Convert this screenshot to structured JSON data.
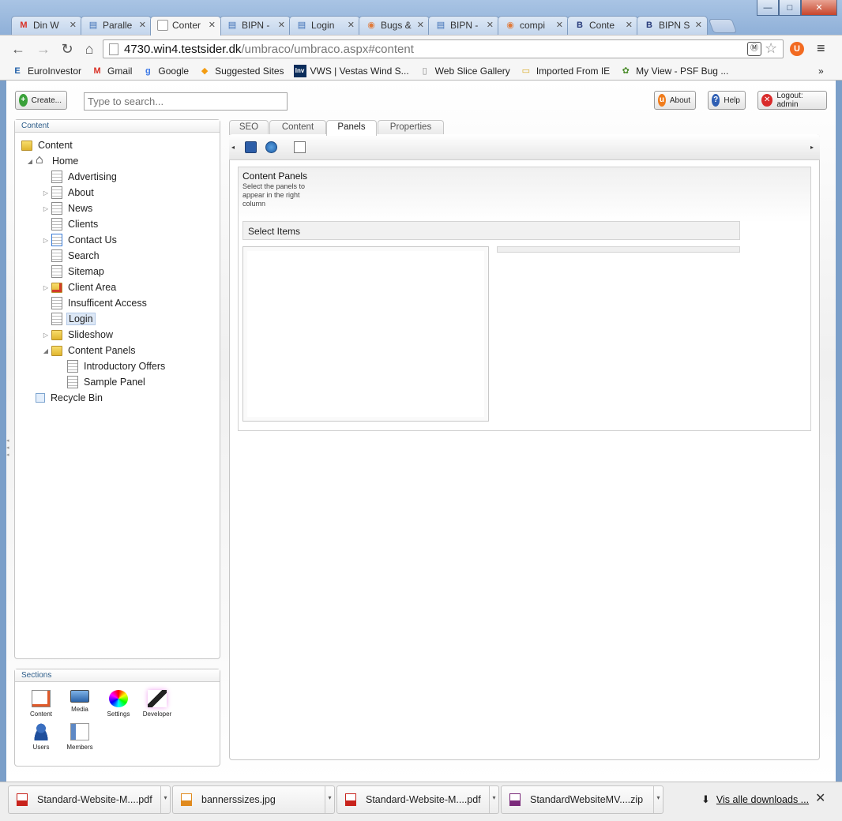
{
  "window": {
    "minimize": "—",
    "maximize": "□",
    "close": "✕"
  },
  "tabs": [
    {
      "label": "Din W",
      "icon": "M",
      "color": "#d93025"
    },
    {
      "label": "Paralle",
      "icon": "▤",
      "color": "#3b6db4"
    },
    {
      "label": "Conter",
      "icon": "",
      "color": "#888888"
    },
    {
      "label": "BIPN -",
      "icon": "▤",
      "color": "#3b6db4"
    },
    {
      "label": "Login",
      "icon": "▤",
      "color": "#3b6db4"
    },
    {
      "label": "Bugs &",
      "icon": "◉",
      "color": "#e07a3a"
    },
    {
      "label": "BIPN -",
      "icon": "▤",
      "color": "#3b6db4"
    },
    {
      "label": "compi",
      "icon": "◉",
      "color": "#e07a3a"
    },
    {
      "label": "Conte",
      "icon": "B",
      "color": "#273a7a"
    },
    {
      "label": "BIPN S",
      "icon": "B",
      "color": "#273a7a"
    }
  ],
  "address": {
    "host": "4730.win4.testsider.dk",
    "path": "/umbraco/umbraco.aspx#content"
  },
  "bookmarks": [
    {
      "label": "EuroInvestor",
      "icon": "E",
      "color": "#1f5fa8"
    },
    {
      "label": "Gmail",
      "icon": "M",
      "color": "#d93025"
    },
    {
      "label": "Google",
      "icon": "g",
      "color": "#3b78e7"
    },
    {
      "label": "Suggested Sites",
      "icon": "◆",
      "color": "#f39c12"
    },
    {
      "label": "VWS | Vestas Wind S...",
      "icon": "Inv",
      "color": "#0b2d5b"
    },
    {
      "label": "Web Slice Gallery",
      "icon": "▯",
      "color": "#888888"
    },
    {
      "label": "Imported From IE",
      "icon": "▭",
      "color": "#d8a922"
    },
    {
      "label": "My View - PSF Bug ...",
      "icon": "✿",
      "color": "#4a8c2a"
    }
  ],
  "bookmarks_more": "»",
  "header": {
    "create_label": "Create...",
    "search_placeholder": "Type to search...",
    "about_label": "About",
    "help_label": "Help",
    "logout_label": "Logout: admin"
  },
  "content_panel": {
    "title": "Content",
    "tree": [
      {
        "label": "Content",
        "type": "folder",
        "level": 0,
        "arrow": ""
      },
      {
        "label": "Home",
        "type": "home",
        "level": 1,
        "arrow": "◢"
      },
      {
        "label": "Advertising",
        "type": "doc",
        "level": 2,
        "arrow": ""
      },
      {
        "label": "About",
        "type": "doc",
        "level": 2,
        "arrow": "▷"
      },
      {
        "label": "News",
        "type": "doc",
        "level": 2,
        "arrow": "▷"
      },
      {
        "label": "Clients",
        "type": "doc",
        "level": 2,
        "arrow": ""
      },
      {
        "label": "Contact Us",
        "type": "redirect",
        "level": 2,
        "arrow": "▷"
      },
      {
        "label": "Search",
        "type": "doc",
        "level": 2,
        "arrow": ""
      },
      {
        "label": "Sitemap",
        "type": "doc",
        "level": 2,
        "arrow": ""
      },
      {
        "label": "Client Area",
        "type": "folder-protected",
        "level": 2,
        "arrow": "▷"
      },
      {
        "label": "Insufficent Access",
        "type": "doc",
        "level": 2,
        "arrow": ""
      },
      {
        "label": "Login",
        "type": "doc",
        "level": 2,
        "arrow": "",
        "selected": true
      },
      {
        "label": "Slideshow",
        "type": "folder",
        "level": 2,
        "arrow": "▷"
      },
      {
        "label": "Content Panels",
        "type": "folder",
        "level": 2,
        "arrow": "◢"
      },
      {
        "label": "Introductory Offers",
        "type": "doc",
        "level": 3,
        "arrow": ""
      },
      {
        "label": "Sample Panel",
        "type": "doc",
        "level": 3,
        "arrow": ""
      },
      {
        "label": "Recycle Bin",
        "type": "bin",
        "level": 1,
        "arrow": ""
      }
    ]
  },
  "sections_panel": {
    "title": "Sections",
    "items": [
      {
        "label": "Content",
        "icon": "pencil-doc-icon"
      },
      {
        "label": "Media",
        "icon": "monitor-icon"
      },
      {
        "label": "Settings",
        "icon": "color-wheel-icon"
      },
      {
        "label": "Developer",
        "icon": "magic-wand-icon"
      },
      {
        "label": "Users",
        "icon": "user-icon"
      },
      {
        "label": "Members",
        "icon": "member-card-icon"
      }
    ]
  },
  "editor": {
    "tabs": [
      "SEO",
      "Content",
      "Panels",
      "Properties"
    ],
    "active_tab": "Panels",
    "property_title": "Content Panels",
    "property_description": "Select the panels to appear in the right column",
    "select_header": "Select Items"
  },
  "downloads": {
    "items": [
      {
        "label": "Standard-Website-M....pdf",
        "icon": "pdf-icon"
      },
      {
        "label": "bannerssizes.jpg",
        "icon": "image-icon"
      },
      {
        "label": "Standard-Website-M....pdf",
        "icon": "pdf-icon"
      },
      {
        "label": "StandardWebsiteMV....zip",
        "icon": "archive-icon"
      }
    ],
    "show_all": "Vis alle downloads ...",
    "close": "✕"
  }
}
